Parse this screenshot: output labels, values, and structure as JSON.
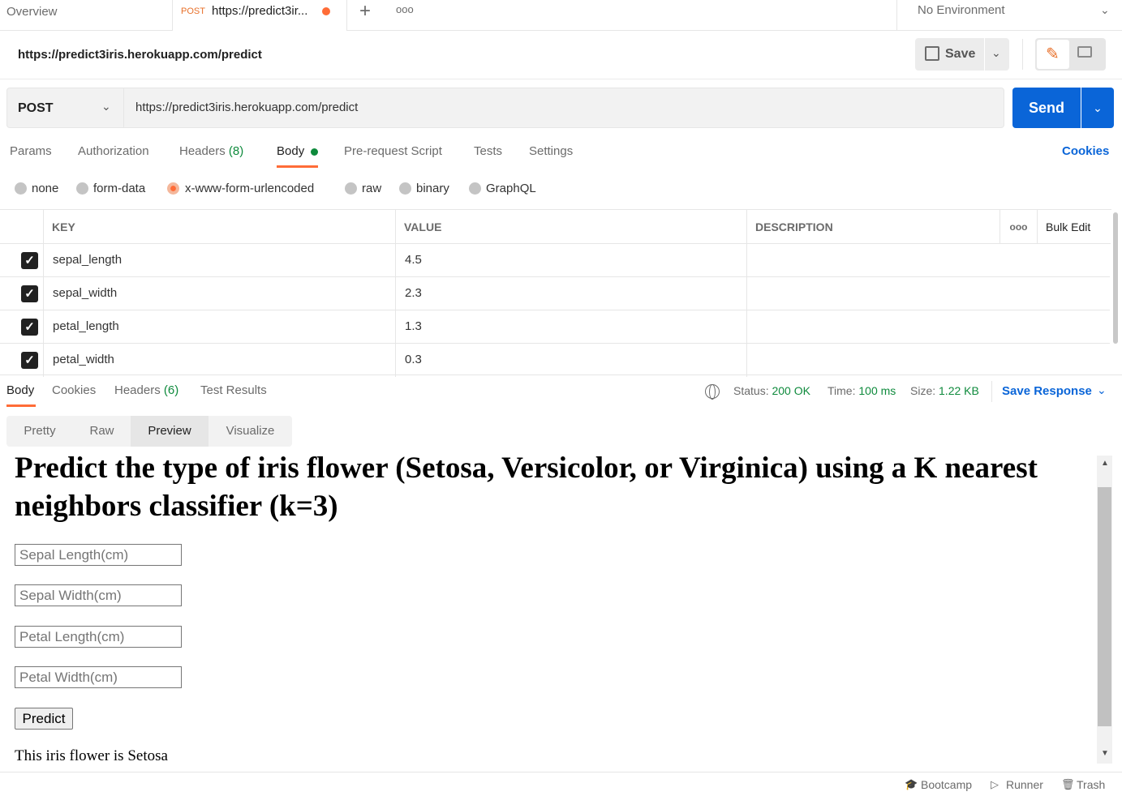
{
  "tabs": {
    "overview_label": "Overview",
    "active_method": "POST",
    "active_url": "https://predict3ir...",
    "new_tab_glyph": "+",
    "more_glyph": "ooo"
  },
  "environment": {
    "label": "No Environment"
  },
  "request": {
    "title": "https://predict3iris.herokuapp.com/predict",
    "save_label": "Save",
    "method": "POST",
    "url": "https://predict3iris.herokuapp.com/predict",
    "send_label": "Send"
  },
  "request_tabs": {
    "params": "Params",
    "authorization": "Authorization",
    "headers": "Headers",
    "headers_count": "(8)",
    "body": "Body",
    "pre_request": "Pre-request Script",
    "tests": "Tests",
    "settings": "Settings",
    "cookies": "Cookies"
  },
  "body_types": {
    "none": "none",
    "form_data": "form-data",
    "urlencoded": "x-www-form-urlencoded",
    "raw": "raw",
    "binary": "binary",
    "graphql": "GraphQL",
    "selected": "x-www-form-urlencoded"
  },
  "params_table": {
    "headers": {
      "key": "KEY",
      "value": "VALUE",
      "description": "DESCRIPTION",
      "more": "ooo",
      "bulk_edit": "Bulk Edit"
    },
    "rows": [
      {
        "key": "sepal_length",
        "value": "4.5",
        "checked": true
      },
      {
        "key": "sepal_width",
        "value": "2.3",
        "checked": true
      },
      {
        "key": "petal_length",
        "value": "1.3",
        "checked": true
      },
      {
        "key": "petal_width",
        "value": "0.3",
        "checked": true
      }
    ]
  },
  "response": {
    "tabs": {
      "body": "Body",
      "cookies": "Cookies",
      "headers": "Headers",
      "headers_count": "(6)",
      "test_results": "Test Results"
    },
    "status_label": "Status:",
    "status_value": "200 OK",
    "time_label": "Time:",
    "time_value": "100 ms",
    "size_label": "Size:",
    "size_value": "1.22 KB",
    "save_response": "Save Response",
    "view_modes": {
      "pretty": "Pretty",
      "raw": "Raw",
      "preview": "Preview",
      "visualize": "Visualize",
      "selected": "Preview"
    }
  },
  "preview": {
    "heading": "Predict the type of iris flower (Setosa, Versicolor, or Virginica) using a K nearest neighbors classifier (k=3)",
    "placeholders": {
      "sepal_length": "Sepal Length(cm)",
      "sepal_width": "Sepal Width(cm)",
      "petal_length": "Petal Length(cm)",
      "petal_width": "Petal Width(cm)"
    },
    "button": "Predict",
    "result": "This iris flower is Setosa"
  },
  "footer": {
    "bootcamp": "Bootcamp",
    "runner": "Runner",
    "trash": "Trash"
  },
  "colors": {
    "accent_orange": "#ff6c37",
    "brand_blue": "#0a65d8",
    "status_green": "#0e8a3c"
  }
}
